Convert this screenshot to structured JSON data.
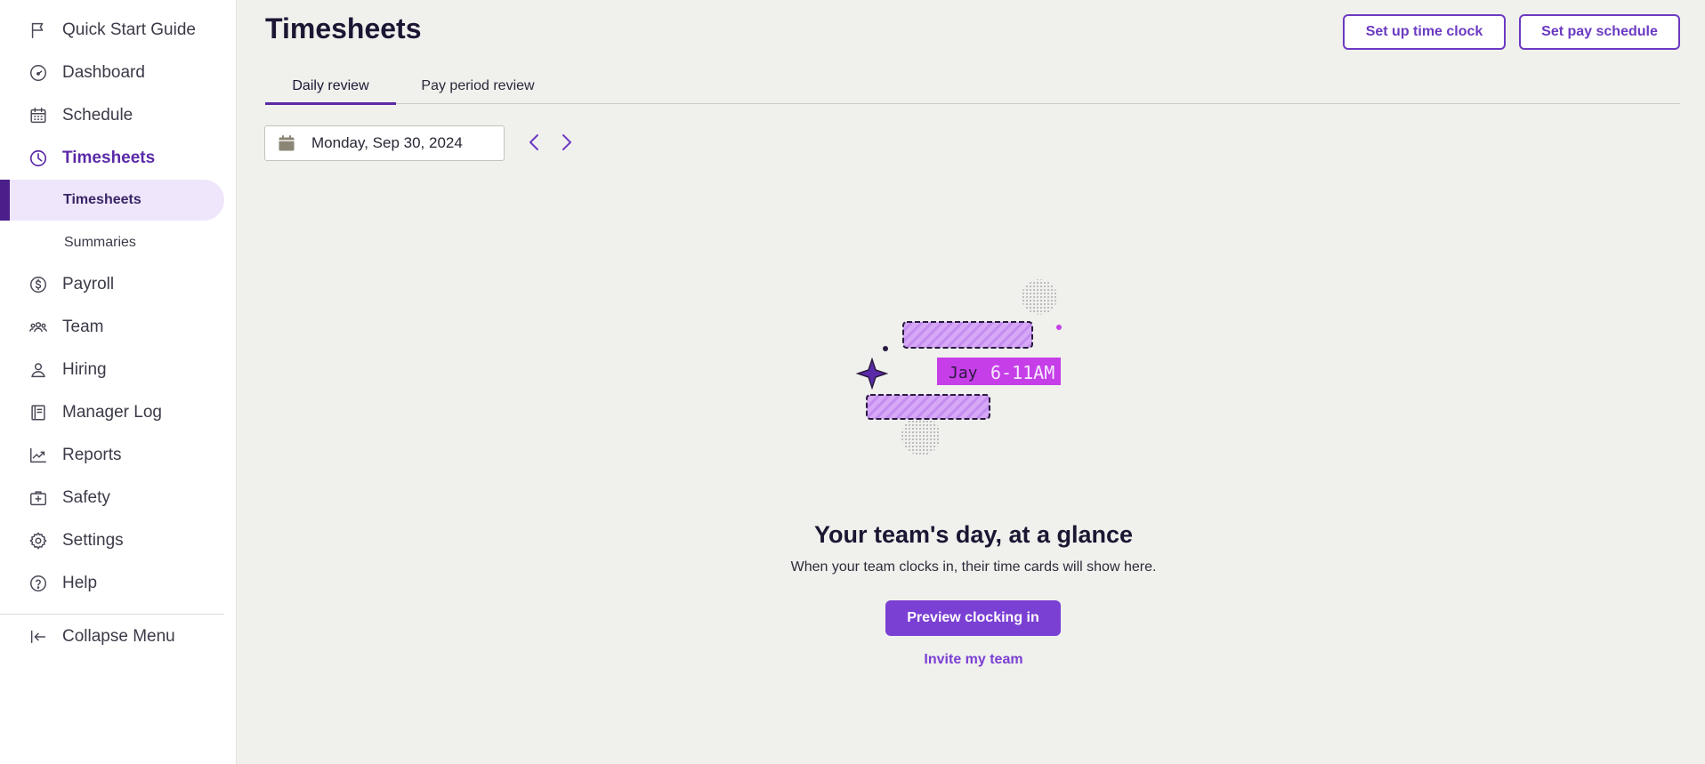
{
  "sidebar": {
    "items": [
      {
        "label": "Quick Start Guide",
        "icon": "flag-icon"
      },
      {
        "label": "Dashboard",
        "icon": "gauge-icon"
      },
      {
        "label": "Schedule",
        "icon": "calendar-icon"
      },
      {
        "label": "Timesheets",
        "icon": "clock-icon",
        "active": true
      },
      {
        "label": "Payroll",
        "icon": "dollar-circle-icon"
      },
      {
        "label": "Team",
        "icon": "team-icon"
      },
      {
        "label": "Hiring",
        "icon": "person-icon"
      },
      {
        "label": "Manager Log",
        "icon": "notebook-icon"
      },
      {
        "label": "Reports",
        "icon": "chart-line-icon"
      },
      {
        "label": "Safety",
        "icon": "first-aid-icon"
      },
      {
        "label": "Settings",
        "icon": "gear-icon"
      },
      {
        "label": "Help",
        "icon": "help-circle-icon"
      }
    ],
    "subitems": [
      {
        "label": "Timesheets",
        "active": true
      },
      {
        "label": "Summaries"
      }
    ],
    "collapse_label": "Collapse Menu",
    "collapse_icon": "collapse-left-icon"
  },
  "header": {
    "title": "Timesheets",
    "time_clock_label": "Set up time clock",
    "pay_schedule_label": "Set pay schedule"
  },
  "tabs": [
    {
      "label": "Daily review",
      "active": true
    },
    {
      "label": "Pay period review"
    }
  ],
  "date_picker": {
    "value": "Monday, Sep 30, 2024",
    "icon": "calendar-icon"
  },
  "empty_state": {
    "illustration_text_1": "Jay",
    "illustration_text_2": "6-11AM",
    "title": "Your team's day, at a glance",
    "subtitle": "When your team clocks in, their time cards will show here.",
    "primary_label": "Preview clocking in",
    "link_label": "Invite my team"
  },
  "colors": {
    "accent": "#7a3fd3",
    "accent_dark": "#5b2aa8",
    "page_bg": "#f0f0ed",
    "sidebar_active_bg": "#efe6fb",
    "illustration_magenta": "#c63ee8",
    "illustration_lavender": "#d6a8f5"
  }
}
